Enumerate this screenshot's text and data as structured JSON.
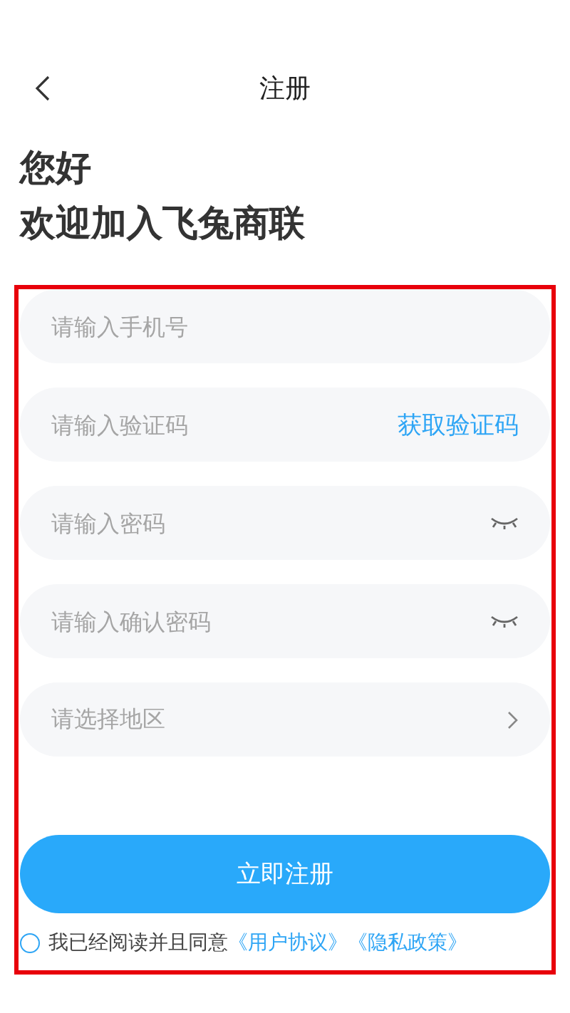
{
  "header": {
    "title": "注册"
  },
  "greeting": [
    "您好",
    "欢迎加入飞兔商联"
  ],
  "fields": [
    {
      "kind": "text",
      "placeholder": "请输入手机号"
    },
    {
      "kind": "code",
      "placeholder": "请输入验证码",
      "action": "获取验证码"
    },
    {
      "kind": "password",
      "placeholder": "请输入密码"
    },
    {
      "kind": "password",
      "placeholder": "请输入确认密码"
    },
    {
      "kind": "select",
      "placeholder": "请选择地区"
    }
  ],
  "submit": "立即注册",
  "agreement": {
    "checked": false,
    "text": "我已经阅读并且同意",
    "links": [
      "《用户协议》",
      "《隐私政策》"
    ]
  }
}
